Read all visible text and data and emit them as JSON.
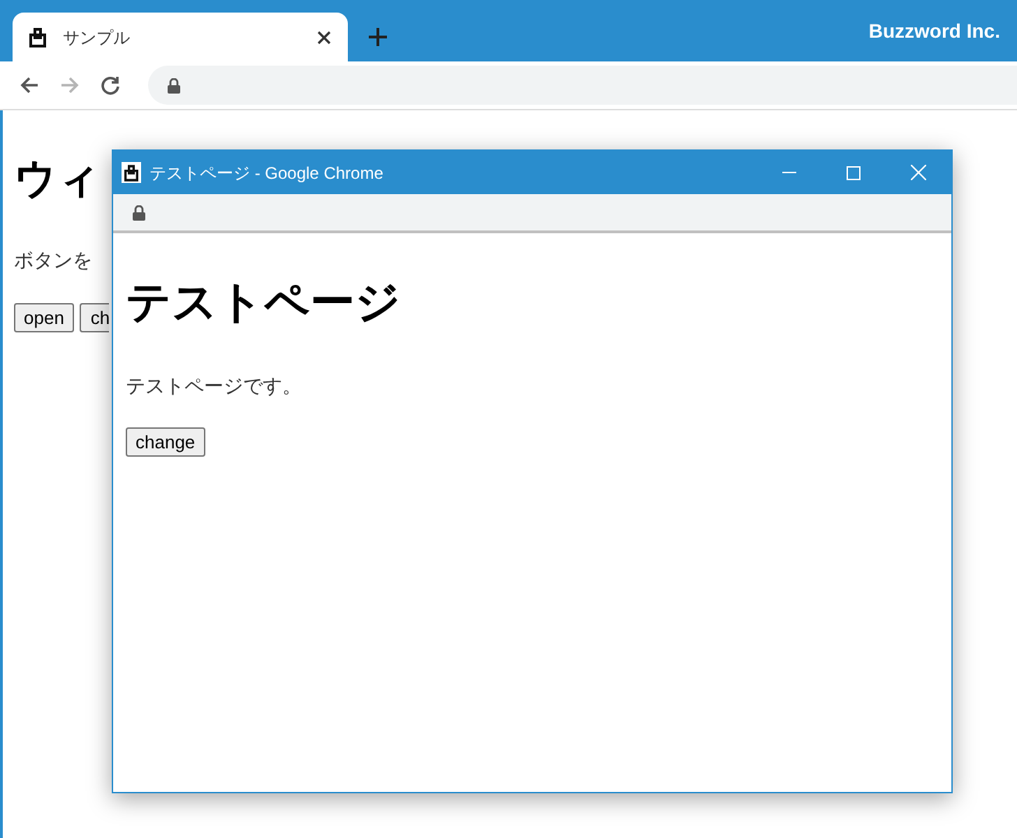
{
  "browser": {
    "tab": {
      "title": "サンプル",
      "selected": true
    },
    "brand": "Buzzword Inc.",
    "nav": [
      {
        "kind": "back",
        "disabled": false
      },
      {
        "kind": "forward",
        "disabled": true
      },
      {
        "kind": "reload",
        "disabled": false
      }
    ]
  },
  "page": {
    "heading": "ウィ",
    "text": "ボタンを",
    "buttons": [
      "open",
      "ch"
    ]
  },
  "popup": {
    "title": "テストページ - Google Chrome",
    "heading": "テストページ",
    "text": "テストページです。",
    "button": "change"
  }
}
